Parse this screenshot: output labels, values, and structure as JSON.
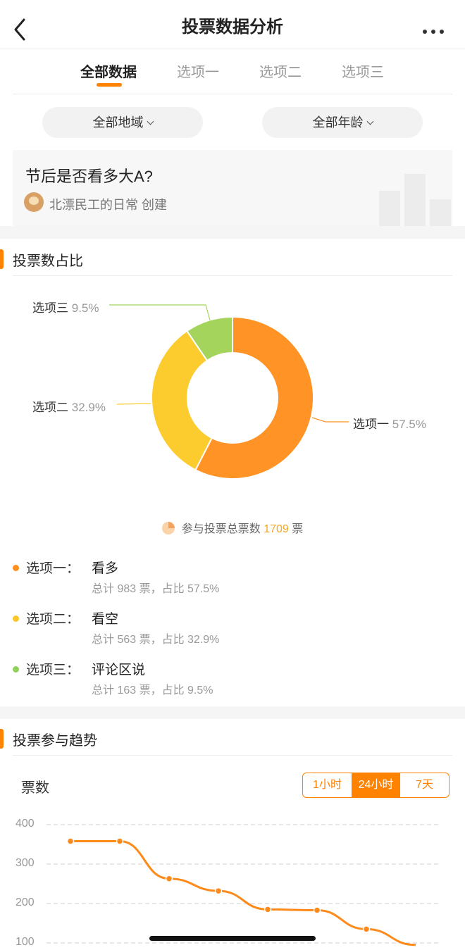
{
  "nav": {
    "title": "投票数据分析",
    "back_icon": "chevron-left-icon",
    "more_icon": "more-dots-icon"
  },
  "tabs": [
    "全部数据",
    "选项一",
    "选项二",
    "选项三"
  ],
  "filters": {
    "region": "全部地域",
    "age": "全部年龄"
  },
  "poll": {
    "question": "节后是否看多大A?",
    "creator": "北漂民工的日常 创建"
  },
  "section_share": {
    "title": "投票数占比"
  },
  "donut": {
    "labels": [
      {
        "name": "选项一",
        "pct": "57.5%"
      },
      {
        "name": "选项二",
        "pct": "32.9%"
      },
      {
        "name": "选项三",
        "pct": "9.5%"
      }
    ],
    "colors": [
      "#ff9326",
      "#fccb2e",
      "#a4d45c"
    ]
  },
  "total": {
    "prefix": "参与投票总票数",
    "count": "1709",
    "suffix": "票"
  },
  "options": [
    {
      "name": "选项一：",
      "answer": "看多",
      "stat": "总计 983 票，占比 57.5%",
      "color": "#ff8f1f"
    },
    {
      "name": "选项二：",
      "answer": "看空",
      "stat": "总计 563 票，占比 32.9%",
      "color": "#fcc62b"
    },
    {
      "name": "选项三：",
      "answer": "评论区说",
      "stat": "总计 163 票，占比 9.5%",
      "color": "#8fd15a"
    }
  ],
  "section_trend": {
    "title": "投票参与趋势"
  },
  "trend": {
    "ylabel": "票数",
    "ranges": [
      "1小时",
      "24小时",
      "7天"
    ],
    "active_range": "24小时"
  },
  "chart_data": [
    {
      "type": "pie",
      "categories": [
        "选项一",
        "选项二",
        "选项三"
      ],
      "values": [
        57.5,
        32.9,
        9.5
      ],
      "counts": [
        983,
        563,
        163
      ],
      "title": "投票数占比",
      "colors": [
        "#ff9326",
        "#fccb2e",
        "#a4d45c"
      ]
    },
    {
      "type": "line",
      "ylabel": "票数",
      "yticks": [
        400,
        300,
        200,
        100
      ],
      "ylim": [
        100,
        400
      ],
      "grid": true,
      "series": [
        {
          "values": [
            358,
            358,
            263,
            232,
            185,
            183,
            135,
            95
          ]
        }
      ]
    }
  ]
}
